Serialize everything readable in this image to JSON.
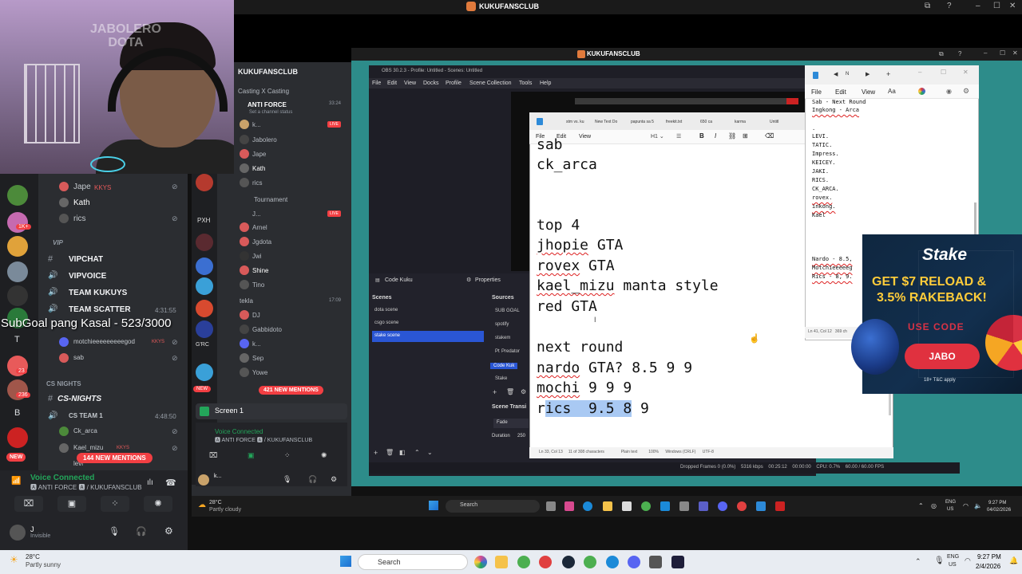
{
  "outer": {
    "title": "KUKUFANSCLUB",
    "controls": [
      "–",
      "☐",
      "✕"
    ]
  },
  "webcam": {
    "logo_line1": "JABOLERO",
    "logo_line2": "DOTA"
  },
  "overlay": {
    "subgoal": "SubGoal pang Kasal - 523/3000"
  },
  "discord_left": {
    "server_badges": [
      "1K+",
      "23",
      "236"
    ],
    "server_letters": [
      "T",
      "B"
    ],
    "new_pill": "NEW",
    "top_members": [
      {
        "name": "Jape",
        "tag": "KKYS"
      },
      {
        "name": "Kath",
        "tag": ""
      },
      {
        "name": "rics",
        "tag": ""
      }
    ],
    "vip_category": "VIP",
    "channels": [
      "VIPCHAT",
      "VIPVOICE",
      "TEAM KUKUYS",
      "TEAM SCATTER"
    ],
    "team_scatter_time": "4:31:55",
    "scatter_members": [
      {
        "name": "motchieeeeeeeeegod",
        "tag": "KKYS"
      },
      {
        "name": "sab",
        "tag": ""
      }
    ],
    "cs_category": "CS NIGHTS",
    "cs_channel": "CS-NIGHTS",
    "cs_team": "CS TEAM 1",
    "cs_team_time": "4:48:50",
    "cs_members": [
      {
        "name": "Ck_arca",
        "tag": ""
      },
      {
        "name": "Kael_mizu",
        "tag": "KKYS"
      },
      {
        "name": "levi",
        "tag": "TREX"
      }
    ],
    "new_mentions": "144 NEW MENTIONS",
    "voice_connected": "Voice Connected",
    "voice_sub": "🅰 ANTI FORCE 🅰 / KUKUFANSCLUB",
    "user_name": "J",
    "user_status": "Invisible"
  },
  "discord_mid": {
    "server_name": "KUKUFANSCLUB",
    "category": "Casting X Casting",
    "channel1": "ANTI FORCE",
    "channel1_time": "33:24",
    "channel1_status": "Set a channel status",
    "members1": [
      "k...",
      "Jabolero",
      "Jape",
      "Kath",
      "rics"
    ],
    "tournament": "Tournament",
    "members2": [
      "J...",
      "Arnel",
      "Jgdota",
      "Jwi",
      "Shine",
      "Tino"
    ],
    "tekla": "tekla",
    "tekla_time": "17:09",
    "members3": [
      "DJ",
      "Gabbidoto",
      "k...",
      "Sep",
      "Yowe"
    ],
    "rail_labels": [
      "PXH",
      "G'RC",
      "NEW"
    ],
    "new_mentions": "421 NEW MENTIONS",
    "screen_share": "Screen 1",
    "voice_connected": "Voice Connected",
    "voice_sub": "🅰 ANTI FORCE 🅰 / KUKUFANSCLUB",
    "user_name": "k..."
  },
  "inner": {
    "title": "KUKUFANSCLUB"
  },
  "obs": {
    "title": "OBS 30.2.3 - Profile: Untitled - Scenes: Untitled",
    "menus": [
      "File",
      "Edit",
      "View",
      "Docks",
      "Profile",
      "Scene Collection",
      "Tools",
      "Help"
    ],
    "source_label": "Code Kuku",
    "properties_label": "Properties",
    "scenes_title": "Scenes",
    "scenes": [
      "dota scene",
      "csgo scene",
      "stake scene"
    ],
    "sources_title": "Sources",
    "sources": [
      "SUB GOAL",
      "spotify",
      "stakem",
      "Pt",
      "Predator",
      "Code Kuk",
      "Stake"
    ],
    "transition_title": "Scene Transi",
    "transition": "Fade",
    "duration_label": "Duration",
    "duration_value": "250",
    "status": "Dropped Frames 0 (0.0%)    5316 kbps    00:25:12    00:00:00    CPU: 0.7%    60.00 / 60.00 FPS"
  },
  "notepad": {
    "tabs": [
      "stm vs. ku",
      "New Text Do",
      "papunta sa 5",
      "freekit.txt",
      "650 ca",
      "karma",
      "Untitl"
    ],
    "menus": [
      "File",
      "Edit",
      "View"
    ],
    "lines": [
      {
        "text": "sab",
        "err": false
      },
      {
        "text": "ck_arca",
        "err": false
      },
      {
        "text": "",
        "err": false
      },
      {
        "text": "",
        "err": false
      },
      {
        "text": "top 4",
        "err": false
      },
      {
        "text": "jhopie",
        "suffix": " GTA",
        "err": true
      },
      {
        "text": "rovex",
        "suffix": " GTA",
        "err": true
      },
      {
        "text": "kael_mizu",
        "suffix": " manta style",
        "err": true
      },
      {
        "text": "red GTA",
        "err": false
      },
      {
        "text": "",
        "err": false
      },
      {
        "text": "next round",
        "err": false
      },
      {
        "text": "nardo",
        "suffix": " GTA? 8.5 9 9",
        "err": true
      },
      {
        "text": "mochi",
        "suffix": " 9 9 9",
        "err": true
      }
    ],
    "last_line_pre": "r",
    "last_line_sel": "ics  9.5 8",
    "last_line_post": " 9",
    "status": "Ln 33, Col 13     11 of 308 characters               Plain text          100%      Windows (CRLF)      UTF-8"
  },
  "notepad2": {
    "tab": "Ν",
    "menus": [
      "File",
      "Edit",
      "View"
    ],
    "lines": [
      "Sab - Next Round",
      "Ingkong - Arca",
      "",
      ".",
      "LEVI.",
      "TATIC.",
      "Impress.",
      "KEICEY.",
      "JAKI.",
      "RICS.",
      "CK_ARCA.",
      "rovex.",
      "inkong.",
      "Kael",
      "",
      "",
      "",
      "",
      "Nardo - 8.5,",
      "Motchieeeeeg",
      "Rics - 8, 9."
    ],
    "status": "Ln 41, Col 12   369 ch"
  },
  "stake": {
    "logo": "Stake",
    "line1": "GET $7 RELOAD &",
    "line2": "3.5% RAKEBACK!",
    "code_label": "USE CODE",
    "code": "JABO",
    "tc": "18+  T&C apply"
  },
  "inner_taskbar": {
    "temp": "28°C",
    "weather": "Partly cloudy",
    "search": "Search",
    "lang1": "ENG",
    "lang2": "US",
    "time": "9:27 PM",
    "date": "04/02/2026"
  },
  "taskbar": {
    "temp": "28°C",
    "weather": "Partly sunny",
    "search": "Search",
    "lang1": "ENG",
    "lang2": "US",
    "time": "9:27 PM",
    "date": "2/4/2026"
  },
  "colors": {
    "discord_bg": "#2b2d31",
    "discord_green": "#23a55a",
    "mention_red": "#f23f43",
    "stake_yellow": "#ffcc3a",
    "selection_blue": "#a9c9f3"
  }
}
